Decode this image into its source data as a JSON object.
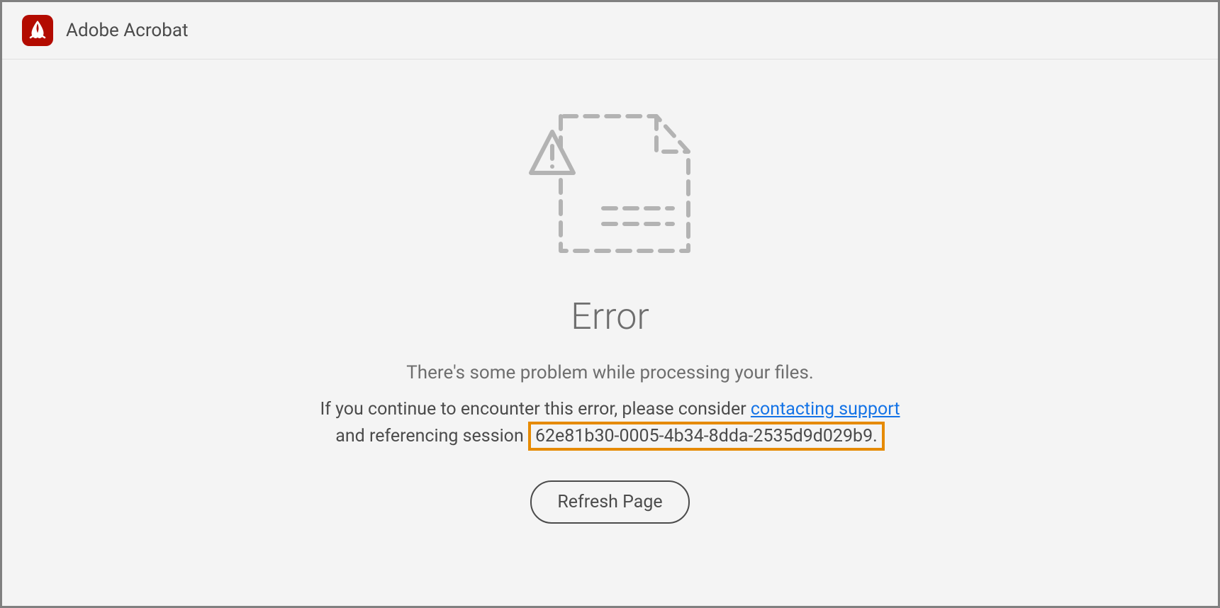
{
  "header": {
    "app_title": "Adobe Acrobat"
  },
  "error": {
    "heading": "Error",
    "subtitle": "There's some problem while processing your files.",
    "detail_prefix": "If you continue to encounter this error, please consider ",
    "support_link_text": "contacting support",
    "detail_mid": " and referencing session ",
    "session_id": "62e81b30-0005-4b34-8dda-2535d9d029b9.",
    "refresh_button_label": "Refresh Page"
  }
}
